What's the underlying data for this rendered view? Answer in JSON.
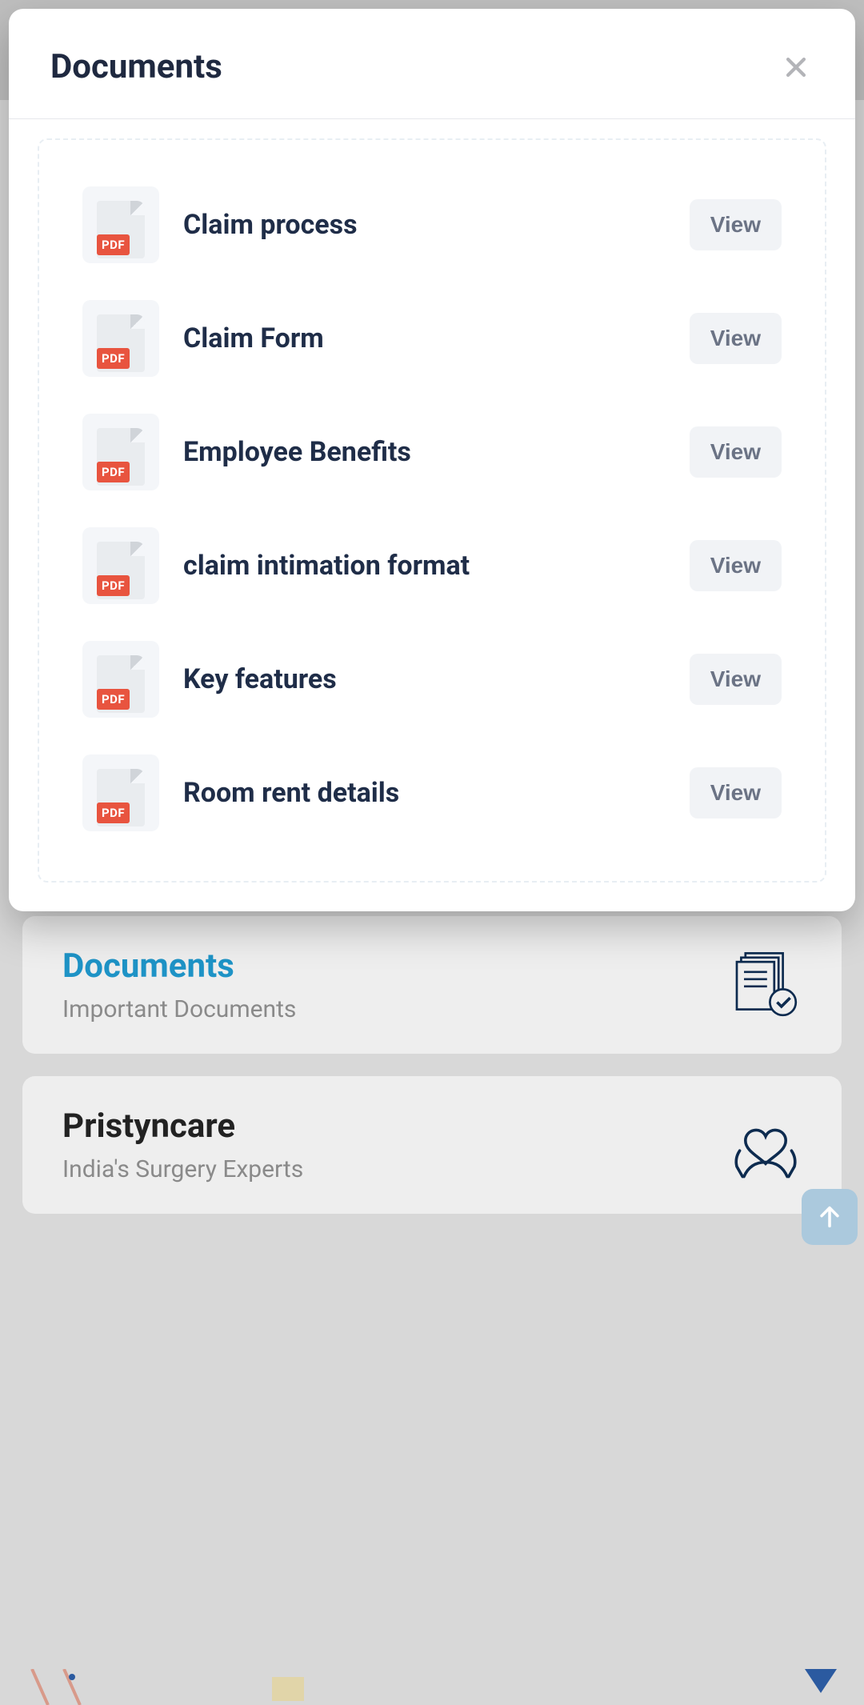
{
  "modal": {
    "title": "Documents",
    "view_label": "View",
    "documents": [
      {
        "title": "Claim process"
      },
      {
        "title": "Claim Form"
      },
      {
        "title": "Employee Benefits"
      },
      {
        "title": "claim intimation format"
      },
      {
        "title": "Key features"
      },
      {
        "title": "Room rent details"
      }
    ],
    "pdf_badge": "PDF"
  },
  "background_cards": [
    {
      "title": "Documents",
      "subtitle": "Important Documents",
      "active": true,
      "icon": "documents-check-icon"
    },
    {
      "title": "Pristyncare",
      "subtitle": "India's Surgery Experts",
      "active": false,
      "icon": "hands-heart-icon"
    }
  ]
}
